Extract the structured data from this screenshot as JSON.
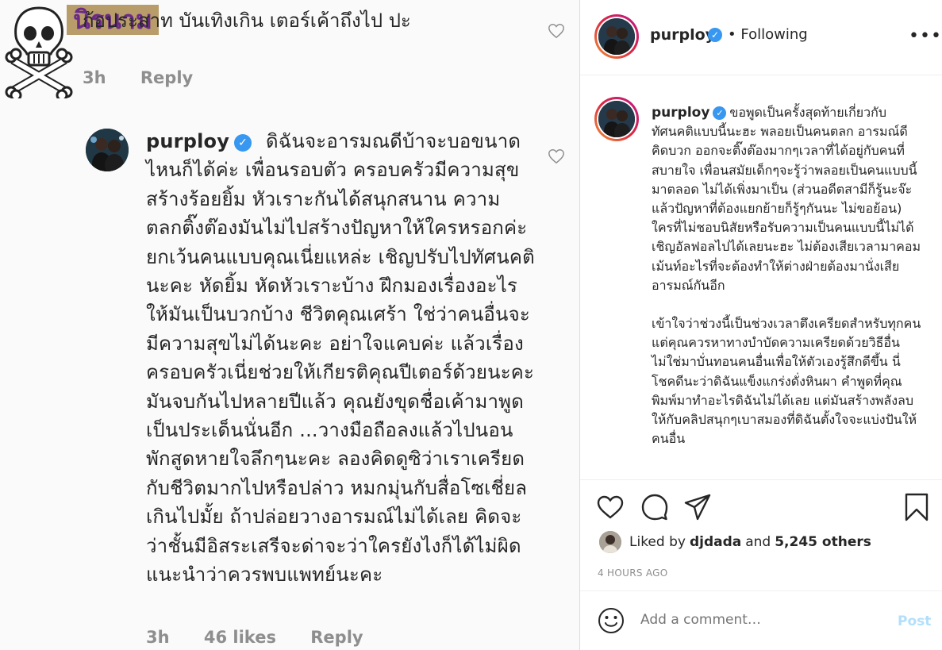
{
  "left": {
    "sticker_label": "นิรนาม",
    "comment1": {
      "text": "ก้อประสาท บันเทิงเกิน เตอร์เค้าถึงไป ปะ",
      "time": "3h",
      "reply": "Reply"
    },
    "comment2": {
      "username": "purploy",
      "text": "ดิฉันจะอารมณดีบ้าจะบอขนาดไหนก็ได้ค่ะ เพื่อนรอบตัว ครอบครัวมีความสุข สร้างร้อยยิ้ม หัวเราะกันได้สนุกสนาน ความตลกติ๊งต๊องมันไม่ไปสร้างปัญหาให้ใครหรอกค่ะ ยกเว้นคนแบบคุณเนี่ยแหล่ะ เชิญปรับไปทัศนคตินะคะ หัดยิ้ม หัดหัวเราะบ้าง ฝึกมองเรื่องอะไรให้มันเป็นบวกบ้าง ชีวิตคุณเศร้า ใช่ว่าคนอื่นจะมีความสุขไม่ได้นะคะ อย่าใจแคบค่ะ แล้วเรื่องครอบครัวเนี่ยช่วยให้เกียรติคุณปีเตอร์ด้วยนะคะ มันจบกันไปหลายปีแล้ว คุณยังขุดชื่อเค้ามาพูดเป็นประเด็นนั่นอีก ...วางมือถือลงแล้วไปนอนพักสูดหายใจลึกๆนะคะ ลองคิดดูซิว่าเราเครียดกับชีวิตมากไปหรือปล่าว หมกมุ่นกับสื่อโซเชี่ยลเกินไปมั้ย ถ้าปล่อยวางอารมณ์ไม่ได้เลย คิดจะว่าชั้นมีอิสระเสรีจะด่าจะว่าใครยังไงก็ได้ไม่ผิด แนะนำว่าควรพบแพทย์นะคะ",
      "time": "3h",
      "likes": "46 likes",
      "reply": "Reply"
    }
  },
  "right": {
    "header": {
      "username": "purploy",
      "separator": "•",
      "follow_status": "Following",
      "more": "•••"
    },
    "caption": {
      "username": "purploy",
      "para1": "ขอพูดเป็นครั้งสุดท้ายเกี่ยวกับทัศนคติแบบนี้นะฮะ พลอยเป็นคนตลก อารมณ์ดี คิดบวก ออกจะติ๊งต๊องมากๆเวลาที่ได้อยู่กับคนที่สบายใจ เพื่อนสมัยเด็กๆจะรู้ว่าพลอยเป็นคนแบบนี้มาตลอด ไม่ได้เพิ่งมาเป็น (ส่วนอดีตสามีก็รู้นะจ๊ะ แล้วปัญหาที่ต้องแยกย้ายก็รู้ๆกันนะ ไม่ขอย้อน) ใครที่ไม่ชอบนิสัยหรือรับความเป็นคนแบบนี้ไม่ได้ เชิญอัลฟอลไปได้เลยนะฮะ ไม่ต้องเสียเวลามาคอมเม้นท์อะไรที่จะต้องทำให้ต่างฝ่ายต้องมานั่งเสียอารมณ์กันอีก",
      "para2": "เข้าใจว่าช่วงนี้เป็นช่วงเวลาตึงเครียดสำหรับทุกคน แต่คุณควรหาทางบำบัดความเครียดด้วยวิธีอื่น ไม่ใช่มาบั่นทอนคนอื่นเพื่อให้ตัวเองรู้สึกดีขึ้น นี่โชคดีนะว่าดิฉันแข็งแกร่งดั่งหินผา คำพูดที่คุณพิมพ์มาทำอะไรดิฉันไม่ได้เลย แต่มันสร้างพลังลบให้กับคลิปสนุกๆเบาสมองที่ดิฉันตั้งใจจะแบ่งปันให้คนอื่น"
    },
    "likes": {
      "prefix": "Liked by",
      "user": "djdada",
      "and": "and",
      "others": "5,245 others"
    },
    "timestamp": "4 HOURS AGO",
    "comment_input": {
      "placeholder": "Add a comment…",
      "post_label": "Post"
    },
    "colors": {
      "verified": "#3897f0",
      "post_disabled": "#b2dffc",
      "muted": "#8e8e8e"
    }
  }
}
